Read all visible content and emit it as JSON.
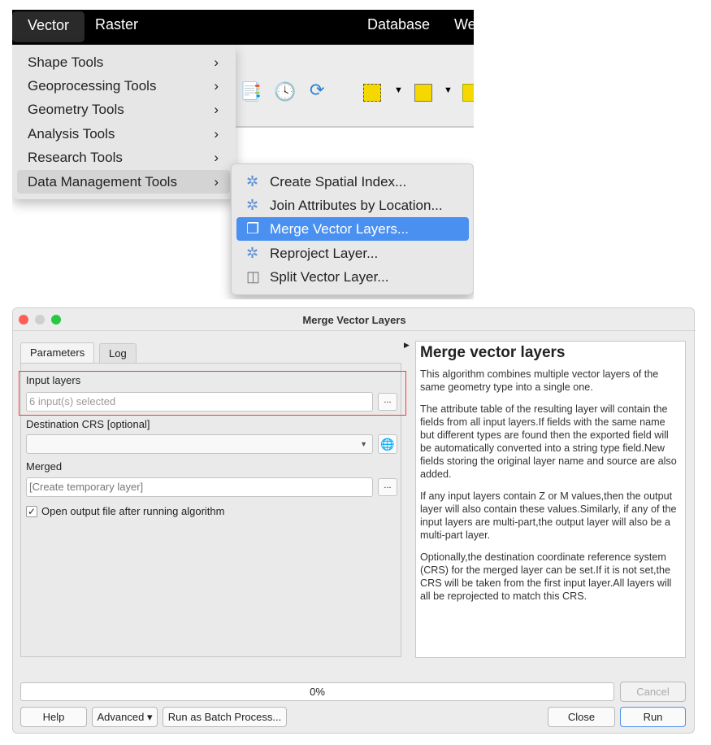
{
  "menubar": {
    "items": [
      "Vector",
      "Raster",
      "Database",
      "We"
    ]
  },
  "vector_menu": {
    "items": [
      {
        "label": "Shape Tools",
        "chevron": "›"
      },
      {
        "label": "Geoprocessing Tools",
        "chevron": "›"
      },
      {
        "label": "Geometry Tools",
        "chevron": "›"
      },
      {
        "label": "Analysis Tools",
        "chevron": "›"
      },
      {
        "label": "Research Tools",
        "chevron": "›"
      },
      {
        "label": "Data Management Tools",
        "chevron": "›"
      }
    ]
  },
  "submenu": {
    "items": [
      {
        "label": "Create Spatial Index...",
        "icon": "gear-icon"
      },
      {
        "label": "Join Attributes by Location...",
        "icon": "gear-icon"
      },
      {
        "label": "Merge Vector Layers...",
        "icon": "merge-icon"
      },
      {
        "label": "Reproject Layer...",
        "icon": "gear-icon"
      },
      {
        "label": "Split Vector Layer...",
        "icon": "split-icon"
      }
    ]
  },
  "dialog": {
    "title": "Merge Vector Layers",
    "tabs": [
      "Parameters",
      "Log"
    ],
    "params": {
      "input_label": "Input layers",
      "input_value": "6 input(s) selected",
      "browse": "...",
      "crs_label": "Destination CRS [optional]",
      "merged_label": "Merged",
      "merged_value": "[Create temporary layer]",
      "merged_btn": "...",
      "open_output_label": "Open output file after running algorithm",
      "open_output_checked": true
    },
    "help": {
      "title": "Merge vector layers",
      "paragraphs": [
        "This algorithm combines multiple vector layers of the same geometry type into a single one.",
        "The attribute table of the resulting layer will contain the fields from all input layers.If fields with the same name but different types are found then the exported field will be automatically converted into a string type field.New fields storing the original layer name and source are also added.",
        "If any input layers contain Z or M values,then the output layer will also contain these values.Similarly, if any of the input layers are multi-part,the output layer will also be a multi-part layer.",
        "Optionally,the destination coordinate reference system (CRS) for the merged layer can be set.If it is not set,the CRS will be taken from the first input layer.All layers will all be reprojected to match this CRS."
      ]
    },
    "progress": {
      "value": 0,
      "label": "0%"
    },
    "buttons": {
      "cancel": "Cancel",
      "help": "Help",
      "advanced": "Advanced ▾",
      "batch": "Run as Batch Process...",
      "close": "Close",
      "run": "Run"
    }
  },
  "colors": {
    "highlight": "#4a90f0",
    "annotation": "#f03c3c"
  }
}
